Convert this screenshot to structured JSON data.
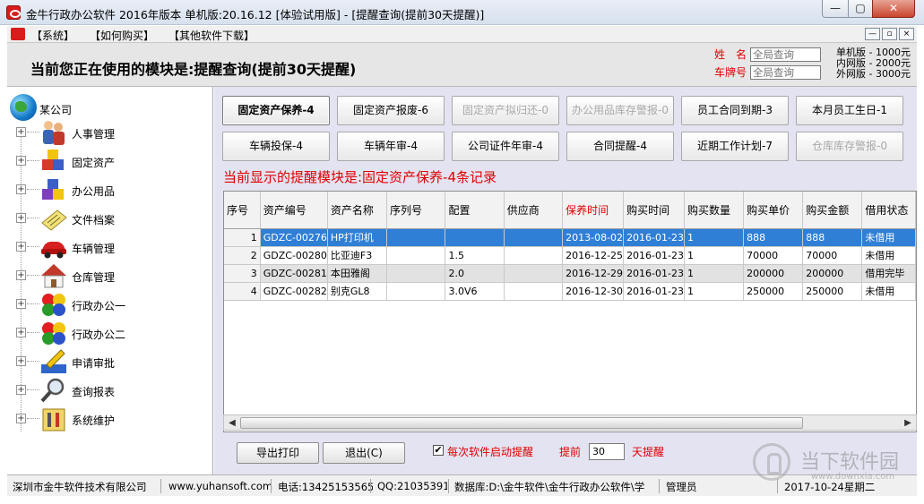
{
  "window": {
    "title": "金牛行政办公软件 2016年版本 单机版:20.16.12 [体验试用版] - [提醒查询(提前30天提醒)]",
    "minimize": "—",
    "maximize": "▢",
    "close": "✕"
  },
  "menu": {
    "items": [
      "【系统】",
      "【如何购买】",
      "【其他软件下载】"
    ],
    "mdi_buttons": [
      "—",
      "▫",
      "×"
    ]
  },
  "header": {
    "module_text": "当前您正在使用的模块是:提醒查询(提前30天提醒)",
    "name_label": "姓　名",
    "name_placeholder": "全局查询",
    "plate_label": "车牌号",
    "plate_placeholder": "全局查询",
    "prices": [
      "单机版 - 1000元",
      "内网版 - 2000元",
      "外网版 - 3000元"
    ]
  },
  "tree": {
    "root": "某公司",
    "nodes": [
      {
        "label": "人事管理",
        "icon": "people-icon"
      },
      {
        "label": "固定资产",
        "icon": "cubes-icon"
      },
      {
        "label": "办公用品",
        "icon": "supplies-icon"
      },
      {
        "label": "文件档案",
        "icon": "document-icon"
      },
      {
        "label": "车辆管理",
        "icon": "car-icon"
      },
      {
        "label": "仓库管理",
        "icon": "house-icon"
      },
      {
        "label": "行政办公一",
        "icon": "circles-icon"
      },
      {
        "label": "行政办公二",
        "icon": "circles-icon"
      },
      {
        "label": "申请审批",
        "icon": "pen-icon"
      },
      {
        "label": "查询报表",
        "icon": "magnifier-icon"
      },
      {
        "label": "系统维护",
        "icon": "tools-icon"
      }
    ],
    "expander": "+"
  },
  "reminder_buttons": {
    "row1": [
      {
        "label": "固定资产保养-4",
        "state": "selected"
      },
      {
        "label": "固定资产报废-6",
        "state": "normal"
      },
      {
        "label": "固定资产拟归还-0",
        "state": "disabled"
      },
      {
        "label": "办公用品库存警报-0",
        "state": "disabled"
      },
      {
        "label": "员工合同到期-3",
        "state": "normal"
      },
      {
        "label": "本月员工生日-1",
        "state": "normal"
      }
    ],
    "row2": [
      {
        "label": "车辆投保-4",
        "state": "normal"
      },
      {
        "label": "车辆年审-4",
        "state": "normal"
      },
      {
        "label": "公司证件年审-4",
        "state": "normal"
      },
      {
        "label": "合同提醒-4",
        "state": "normal"
      },
      {
        "label": "近期工作计划-7",
        "state": "normal"
      },
      {
        "label": "仓库库存警报-0",
        "state": "disabled"
      }
    ]
  },
  "status_text": "当前显示的提醒模块是:固定资产保养-4条记录",
  "grid": {
    "columns": [
      "序号",
      "资产编号",
      "资产名称",
      "序列号",
      "配置",
      "供应商",
      "保养时间",
      "购买时间",
      "购买数量",
      "购买单价",
      "购买金额",
      "借用状态"
    ],
    "rows": [
      [
        "1",
        "GDZC-00276",
        "HP打印机",
        "",
        "",
        "",
        "2013-08-02",
        "2016-01-23",
        "1",
        "888",
        "888",
        "未借用"
      ],
      [
        "2",
        "GDZC-00280",
        "比亚迪F3",
        "",
        "1.5",
        "",
        "2016-12-25",
        "2016-01-23",
        "1",
        "70000",
        "70000",
        "未借用"
      ],
      [
        "3",
        "GDZC-00281",
        "本田雅阁",
        "",
        "2.0",
        "",
        "2016-12-29",
        "2016-01-23",
        "1",
        "200000",
        "200000",
        "借用完毕"
      ],
      [
        "4",
        "GDZC-00282",
        "别克GL8",
        "",
        "3.0V6",
        "",
        "2016-12-30",
        "2016-01-23",
        "1",
        "250000",
        "250000",
        "未借用"
      ]
    ],
    "scroll_left": "◀",
    "scroll_right": "▶"
  },
  "bottom": {
    "export_label": "导出打印",
    "exit_label": "退出(C)",
    "checkbox_checked": true,
    "checkbox_label": "每次软件启动提醒",
    "advance_label": "提前",
    "days_value": "30",
    "days_suffix": "天提醒"
  },
  "statusbar": {
    "company": "深圳市金牛软件技术有限公司",
    "website": "www.yuhansoft.com",
    "phone": "电话:13425153565",
    "qq": "QQ:21035391",
    "database": "数据库:D:\\金牛软件\\金牛行政办公软件\\学",
    "user": "管理员",
    "date": "2017-10-24星期二"
  },
  "watermark": {
    "text": "当下软件园",
    "sub": "www.downxia.com"
  }
}
